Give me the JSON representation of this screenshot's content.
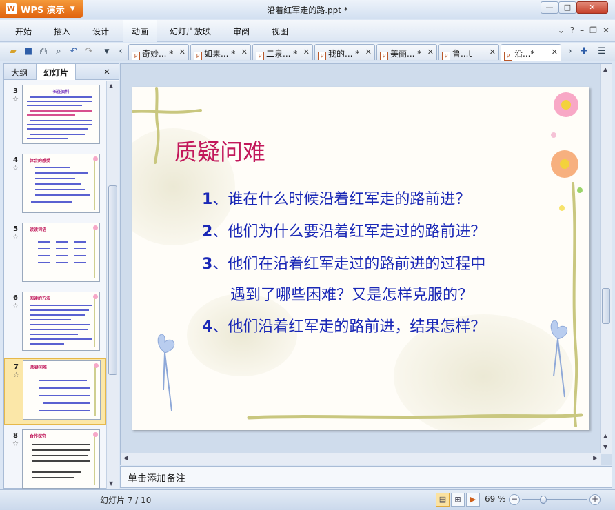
{
  "app": {
    "name": "WPS 演示",
    "logo_glyph": "W"
  },
  "window": {
    "title": "沿着红军走的路.ppt *",
    "minimize": "—",
    "maximize": "□",
    "close": "✕"
  },
  "menu": {
    "items": [
      "开始",
      "插入",
      "设计",
      "动画",
      "幻灯片放映",
      "审阅",
      "视图"
    ],
    "right_icons": [
      "chevron-down-icon",
      "help-icon",
      "minimize-icon",
      "restore-icon",
      "close-icon"
    ],
    "right_glyphs": [
      "⌄",
      "?",
      "–",
      "❐",
      "✕"
    ]
  },
  "doc_tabs": [
    {
      "label": "奇妙... *"
    },
    {
      "label": "如果... *"
    },
    {
      "label": "二泉... *"
    },
    {
      "label": "我的... *"
    },
    {
      "label": "美丽... *"
    },
    {
      "label": "鲁...t"
    },
    {
      "label": "沿...*",
      "active": true
    }
  ],
  "left_panel": {
    "tab_outline": "大纲",
    "tab_slides": "幻灯片",
    "close": "×",
    "thumbnails": [
      {
        "number": "3",
        "title": "长征资料"
      },
      {
        "number": "4",
        "title": "体会的感受"
      },
      {
        "number": "5",
        "title": "读读词语"
      },
      {
        "number": "6",
        "title": "阅读的方法"
      },
      {
        "number": "7",
        "title": "质疑问难",
        "selected": true
      },
      {
        "number": "8",
        "title": "合作探究"
      }
    ]
  },
  "slide": {
    "title": "质疑问难",
    "questions": [
      {
        "num": "1",
        "text": "、谁在什么时候沿着红军走的路前进？"
      },
      {
        "num": "2",
        "text": "、他们为什么要沿着红军走过的路前进？"
      },
      {
        "num": "3",
        "text": "、他们在沿着红军走过的路前进的过程中"
      },
      {
        "num": "",
        "text": "遇到了哪些困难？又是怎样克服的？"
      },
      {
        "num": "4",
        "text": "、他们沿着红军走的路前进，结果怎样？"
      }
    ],
    "colors": {
      "title": "#c2185b",
      "text": "#1a28b6",
      "vine": "#c9c77f"
    }
  },
  "notes": {
    "placeholder": "单击添加备注"
  },
  "status": {
    "slide_count": "幻灯片 7 / 10",
    "zoom": "69 %",
    "zoom_level_percent": 69
  }
}
